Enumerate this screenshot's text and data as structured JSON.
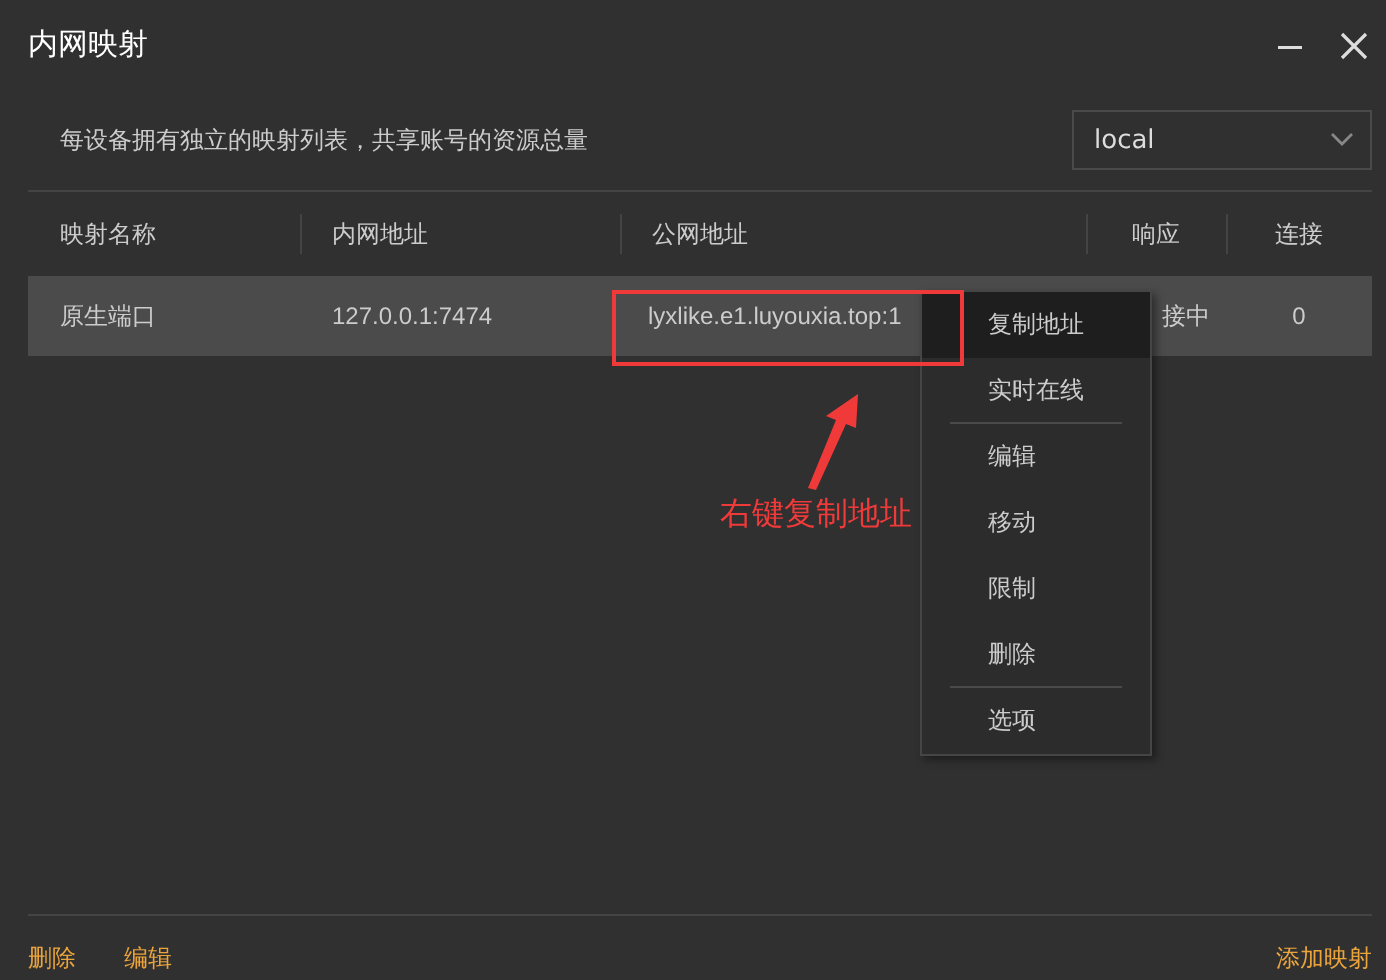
{
  "window": {
    "title": "内网映射"
  },
  "description": "每设备拥有独立的映射列表，共享账号的资源总量",
  "device_select": {
    "value": "local"
  },
  "table": {
    "columns": [
      "映射名称",
      "内网地址",
      "公网地址",
      "响应",
      "连接"
    ],
    "rows": [
      {
        "selected": true,
        "cells": [
          "原生端口",
          "127.0.0.1:7474",
          "lyxlike.e1.luyouxia.top:1",
          "接中",
          "0"
        ]
      }
    ]
  },
  "context_menu": [
    {
      "label": "复制地址",
      "highlighted": true,
      "separator_after": false
    },
    {
      "label": "实时在线",
      "highlighted": false,
      "separator_after": true
    },
    {
      "label": "编辑",
      "highlighted": false,
      "separator_after": false
    },
    {
      "label": "移动",
      "highlighted": false,
      "separator_after": false
    },
    {
      "label": "限制",
      "highlighted": false,
      "separator_after": false
    },
    {
      "label": "删除",
      "highlighted": false,
      "separator_after": true
    },
    {
      "label": "选项",
      "highlighted": false,
      "separator_after": false
    }
  ],
  "annotation": {
    "text": "右键复制地址"
  },
  "footer": {
    "left_links": [
      "删除",
      "编辑"
    ],
    "right_link": "添加映射"
  }
}
